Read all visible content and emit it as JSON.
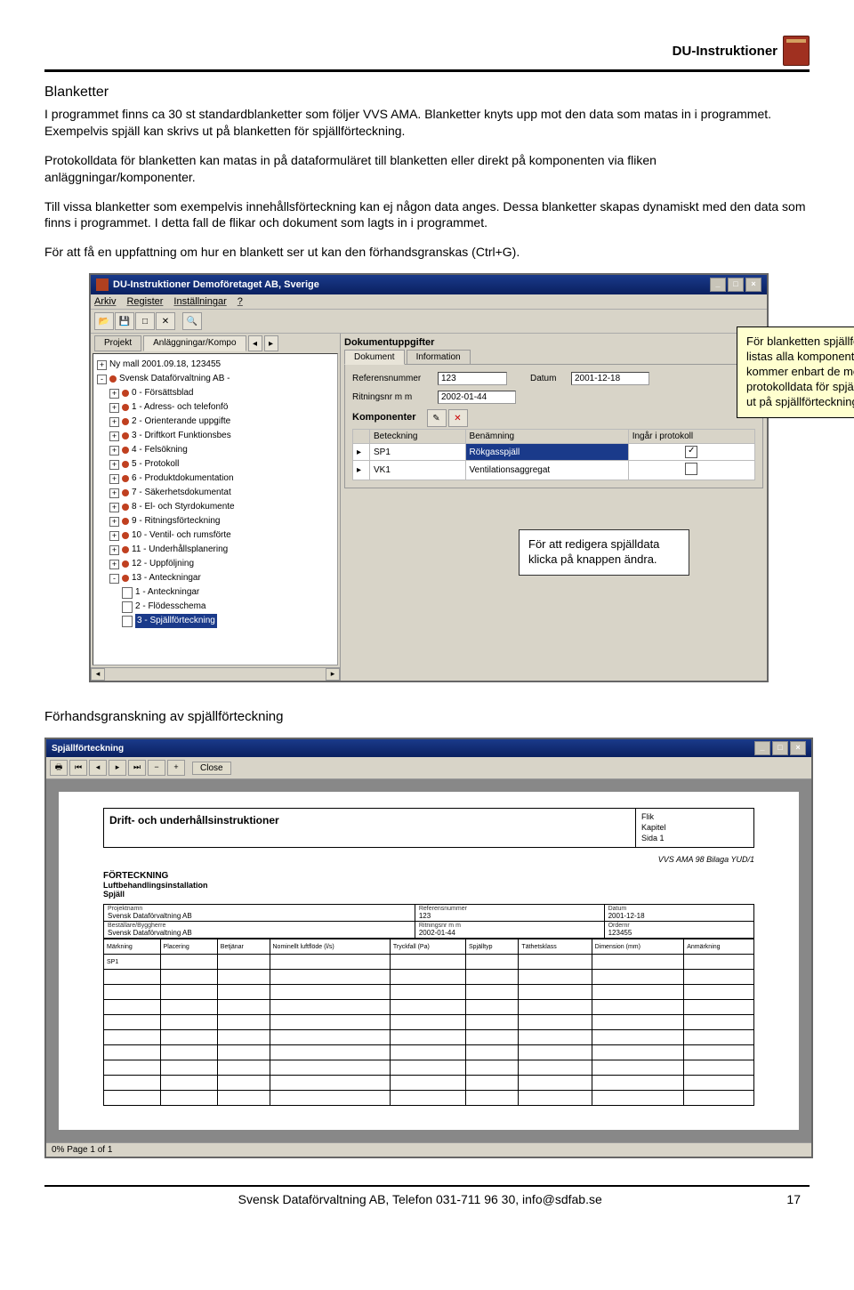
{
  "header": {
    "title": "DU-Instruktioner"
  },
  "section_title": "Blanketter",
  "para1": "I programmet finns ca 30 st standardblanketter som följer VVS AMA. Blanketter knyts upp mot den data som matas in  i programmet. Exempelvis spjäll kan skrivs ut på blanketten för spjällförteckning.",
  "para2": "Protokolldata för blanketten kan matas in på dataformuläret till blanketten eller direkt på komponenten via fliken anläggningar/komponenter.",
  "para3": "Till vissa blanketter som exempelvis innehållsförteckning kan ej någon data anges. Dessa blanketter skapas dynamiskt med den data som finns i programmet. I detta fall de flikar och dokument som lagts in i programmet.",
  "para4": "För att få en uppfattning om hur en blankett ser ut kan den förhandsgranskas (Ctrl+G).",
  "app": {
    "title": "DU-Instruktioner Demoföretaget AB, Sverige",
    "menus": [
      "Arkiv",
      "Register",
      "Inställningar",
      "?"
    ],
    "left_tabs": [
      "Projekt",
      "Anläggningar/Kompo"
    ],
    "tree": [
      {
        "ind": 0,
        "ic": "sq",
        "exp": "+",
        "dot": false,
        "txt": "Ny mall 2001.09.18, 123455"
      },
      {
        "ind": 0,
        "ic": "sq",
        "exp": "-",
        "dot": true,
        "txt": "Svensk Dataförvaltning AB -"
      },
      {
        "ind": 1,
        "ic": "sq",
        "exp": "+",
        "dot": true,
        "txt": "0 - Försättsblad"
      },
      {
        "ind": 1,
        "ic": "sq",
        "exp": "+",
        "dot": true,
        "txt": "1 - Adress- och telefonfö"
      },
      {
        "ind": 1,
        "ic": "sq",
        "exp": "+",
        "dot": true,
        "txt": "2 - Orienterande uppgifte"
      },
      {
        "ind": 1,
        "ic": "sq",
        "exp": "+",
        "dot": true,
        "txt": "3 - Driftkort Funktionsbes"
      },
      {
        "ind": 1,
        "ic": "sq",
        "exp": "+",
        "dot": true,
        "txt": "4 - Felsökning"
      },
      {
        "ind": 1,
        "ic": "sq",
        "exp": "+",
        "dot": true,
        "txt": "5 - Protokoll"
      },
      {
        "ind": 1,
        "ic": "sq",
        "exp": "+",
        "dot": true,
        "txt": "6 - Produktdokumentation"
      },
      {
        "ind": 1,
        "ic": "sq",
        "exp": "+",
        "dot": true,
        "txt": "7 - Säkerhetsdokumentat"
      },
      {
        "ind": 1,
        "ic": "sq",
        "exp": "+",
        "dot": true,
        "txt": "8 - El- och Styrdokumente"
      },
      {
        "ind": 1,
        "ic": "sq",
        "exp": "+",
        "dot": true,
        "txt": "9 - Ritningsförteckning"
      },
      {
        "ind": 1,
        "ic": "sq",
        "exp": "+",
        "dot": true,
        "txt": "10 - Ventil- och rumsförte"
      },
      {
        "ind": 1,
        "ic": "sq",
        "exp": "+",
        "dot": true,
        "txt": "11 - Underhållsplanering"
      },
      {
        "ind": 1,
        "ic": "sq",
        "exp": "+",
        "dot": true,
        "txt": "12 - Uppföljning"
      },
      {
        "ind": 1,
        "ic": "sq",
        "exp": "-",
        "dot": true,
        "txt": "13 - Anteckningar"
      },
      {
        "ind": 2,
        "ic": "doc",
        "txt": "1 - Anteckningar"
      },
      {
        "ind": 2,
        "ic": "doc",
        "txt": "2 - Flödesschema"
      },
      {
        "ind": 2,
        "ic": "doc",
        "sel": true,
        "txt": "3 - Spjällförteckning"
      }
    ],
    "right": {
      "group": "Dokumentuppgifter",
      "tabs": [
        "Dokument",
        "Information"
      ],
      "refnum_label": "Referensnummer",
      "refnum": "123",
      "datum_label": "Datum",
      "datum": "2001-12-18",
      "ritning_label": "Ritningsnr m m",
      "ritning": "2002-01-44",
      "komp_label": "Komponenter",
      "cols": [
        "Beteckning",
        "Benämning",
        "Ingår i protokoll"
      ],
      "rows": [
        {
          "bet": "SP1",
          "ben": "Rökgasspjäll",
          "chk": true,
          "sel": true
        },
        {
          "bet": "VK1",
          "ben": "Ventilationsaggregat",
          "chk": false,
          "sel": false
        }
      ]
    }
  },
  "callout_yellow": "För blanketten spjällförteckning listas alla komponenter. Dock kommer enbart de med protokolldata för spjäll att skrivas ut på spjällförteckningen.",
  "callout_mid": "För att redigera spjälldata klicka på knappen ändra.",
  "preview_caption": "Förhandsgranskning av spjällförteckning",
  "preview": {
    "title": "Spjällförteckning",
    "close": "Close",
    "hdr_l": "Drift- och underhållsinstruktioner",
    "hdr_r": [
      "Flik",
      "Kapitel",
      "Sida        1"
    ],
    "std": "VVS AMA 98 Bilaga YUD/1",
    "fort": "FÖRTECKNING",
    "fort2": "Luftbehandlingsinstallation",
    "fort3": "Spjäll",
    "meta": [
      [
        {
          "l": "Projektnamn",
          "v": "Svensk Dataförvaltning AB"
        },
        {
          "l": "Referensnummer",
          "v": "123"
        },
        {
          "l": "Datum",
          "v": "2001-12-18"
        }
      ],
      [
        {
          "l": "Beställare/Byggherre",
          "v": "Svensk Dataförvaltning AB"
        },
        {
          "l": "Ritningsnr m m",
          "v": "2002-01-44"
        },
        {
          "l": "Ordernr",
          "v": "123455"
        }
      ]
    ],
    "cols": [
      "Märkning",
      "Placering",
      "Betjänar",
      "Nominellt luftflöde (l/s)",
      "Tryckfall (Pa)",
      "Spjälltyp",
      "Täthetsklass",
      "Dimension (mm)",
      "Anmärkning"
    ],
    "rows": [
      "SP1"
    ],
    "status": "0%  Page 1 of 1"
  },
  "footer": {
    "text": "Svensk Dataförvaltning AB, Telefon 031-711 96 30, info@sdfab.se",
    "page": "17"
  }
}
